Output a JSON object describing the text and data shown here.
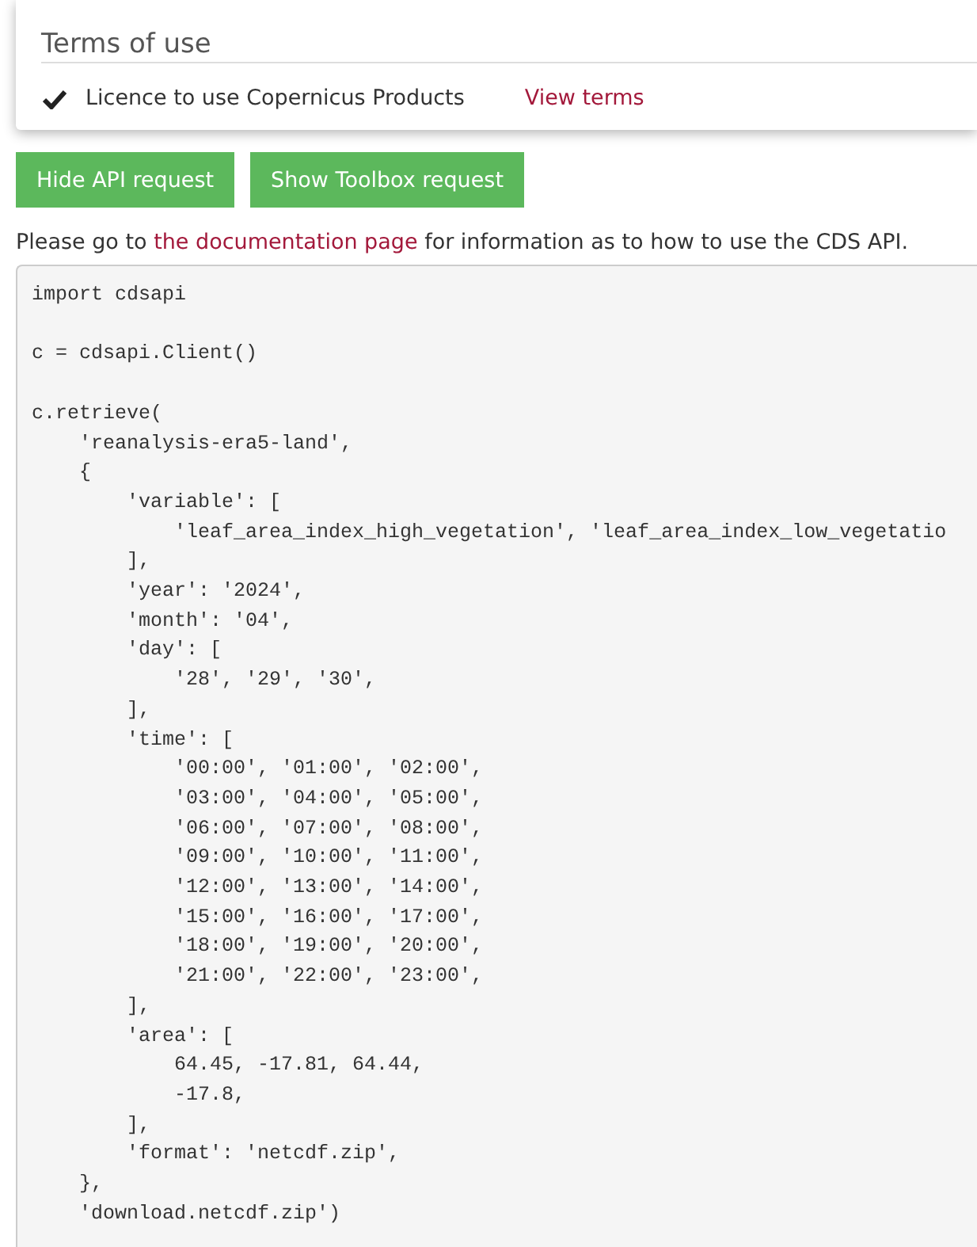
{
  "terms": {
    "title": "Terms of use",
    "licences": [
      {
        "name": "Licence to use Copernicus Products",
        "accepted": true,
        "link": "View terms"
      }
    ]
  },
  "buttons": [
    {
      "label": "Hide API request"
    },
    {
      "label": "Show Toolbox request"
    }
  ],
  "intro": {
    "before": "Please go to ",
    "link": "the documentation page",
    "after": " for information as to how to use the CDS API."
  },
  "code": "import cdsapi\n\nc = cdsapi.Client()\n\nc.retrieve(\n    'reanalysis-era5-land',\n    {\n        'variable': [\n            'leaf_area_index_high_vegetation', 'leaf_area_index_low_vegetatio\n        ],\n        'year': '2024',\n        'month': '04',\n        'day': [\n            '28', '29', '30',\n        ],\n        'time': [\n            '00:00', '01:00', '02:00',\n            '03:00', '04:00', '05:00',\n            '06:00', '07:00', '08:00',\n            '09:00', '10:00', '11:00',\n            '12:00', '13:00', '14:00',\n            '15:00', '16:00', '17:00',\n            '18:00', '19:00', '20:00',\n            '21:00', '22:00', '23:00',\n        ],\n        'area': [\n            64.45, -17.81, 64.44,\n            -17.8,\n        ],\n        'format': 'netcdf.zip',\n    },\n    'download.netcdf.zip')"
}
